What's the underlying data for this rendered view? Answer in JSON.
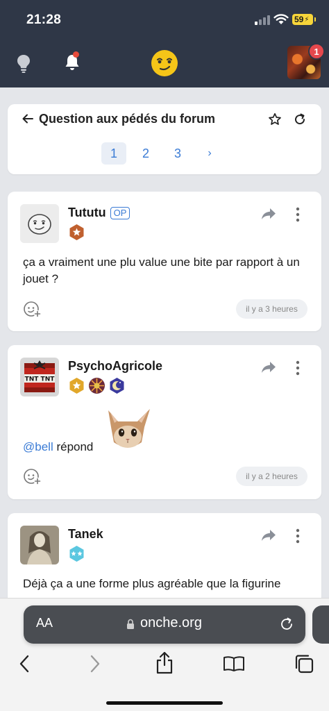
{
  "status_bar": {
    "time": "21:28",
    "battery": "59"
  },
  "app_bar": {
    "notification_count": "1"
  },
  "topic": {
    "title": "Question aux pédés du forum",
    "pages": [
      "1",
      "2",
      "3"
    ],
    "current_page": "1",
    "next_glyph": "›"
  },
  "posts": [
    {
      "author": "Tututu",
      "op_label": "OP",
      "text": "ça a vraiment une plu value une bite par rapport à un jouet ?",
      "time": "il y a 3 heures"
    },
    {
      "author": "PsychoAgricole",
      "mention": "@bell",
      "text": " répond",
      "time": "il y a 2 heures"
    },
    {
      "author": "Tanek",
      "text": "Déjà ça a une forme plus agréable que la figurine"
    }
  ],
  "browser": {
    "aa_label": "AA",
    "url": "onche.org"
  },
  "colors": {
    "header_bg": "#2f3747",
    "link": "#3a7bd5",
    "badge_red": "#e5484d"
  }
}
